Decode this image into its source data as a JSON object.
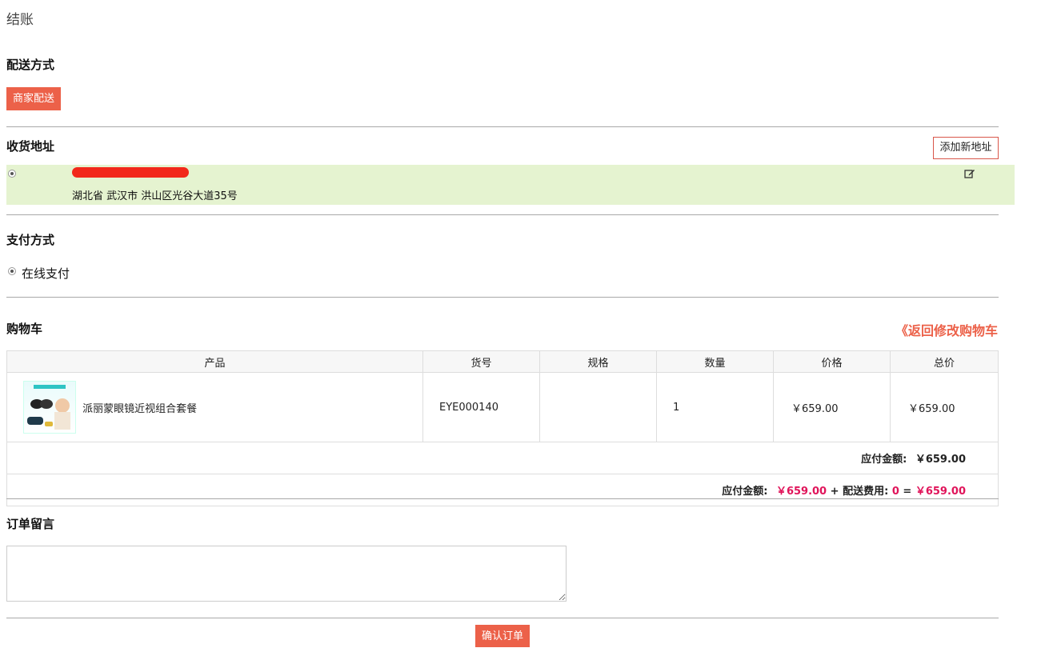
{
  "page_title": "结账",
  "shipping": {
    "title": "配送方式",
    "method_button": "商家配送"
  },
  "address": {
    "title": "收货地址",
    "add_button": "添加新地址",
    "selected_line": "湖北省 武汉市 洪山区光谷大道35号"
  },
  "payment": {
    "title": "支付方式",
    "option_label": "在线支付"
  },
  "cart": {
    "title": "购物车",
    "back_link": "《返回修改购物车",
    "columns": [
      "产品",
      "货号",
      "规格",
      "数量",
      "价格",
      "总价"
    ],
    "rows": [
      {
        "name": "派丽蒙眼镜近视组合套餐",
        "sku": "EYE000140",
        "spec": "",
        "qty": "1",
        "price": "￥659.00",
        "total": "￥659.00"
      }
    ],
    "subtotal_label": "应付金额:",
    "subtotal_value": "￥659.00",
    "final_label": "应付金额:",
    "final_amount": "￥659.00",
    "plus": "+",
    "shipping_fee_label": "配送费用:",
    "shipping_fee_value": "0",
    "equals": "=",
    "final_total": "￥659.00"
  },
  "note": {
    "title": "订单留言",
    "value": ""
  },
  "confirm_button": "确认订单",
  "colors": {
    "accent": "#ec6149",
    "price_red": "#e0145a",
    "selected_bg": "#e5f3d0"
  }
}
